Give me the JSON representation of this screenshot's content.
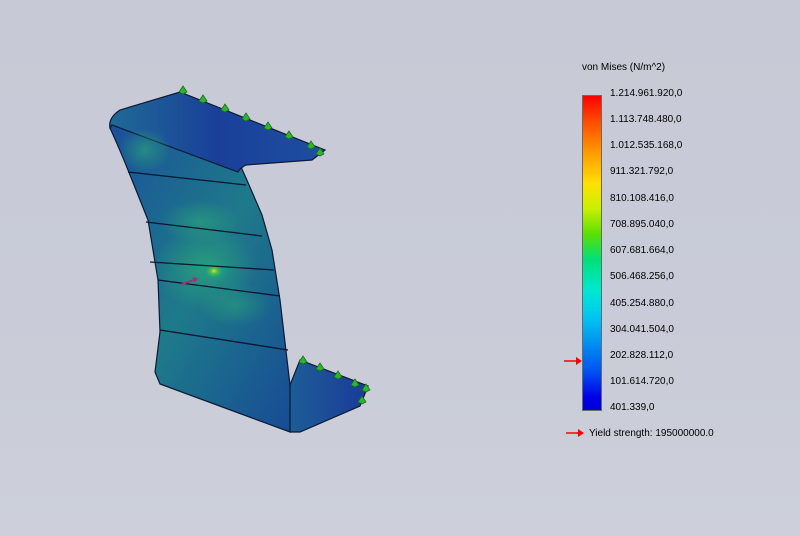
{
  "legend": {
    "title": "von Mises (N/m^2)",
    "ticks": [
      "1.214.961.920,0",
      "1.113.748.480,0",
      "1.012.535.168,0",
      "911.321.792,0",
      "810.108.416,0",
      "708.895.040,0",
      "607.681.664,0",
      "506.468.256,0",
      "405.254.880,0",
      "304.041.504,0",
      "202.828.112,0",
      "101.614.720,0",
      "401.339,0"
    ],
    "yield_label": "Yield strength: 195000000.0",
    "colors": {
      "marker_arrow": "#ff0000",
      "fixture_arrow": "#2db52d",
      "load_arrow": "#a0307a"
    }
  }
}
